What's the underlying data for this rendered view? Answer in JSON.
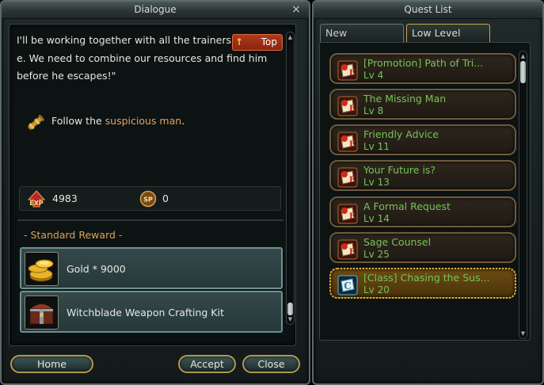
{
  "dialogue": {
    "title": "Dialogue",
    "close_symbol": "×",
    "text_line1": "I'll be working together with all the trainers, if co",
    "text_line2": "e. We need to combine our resources and find him",
    "text_line3": "before he escapes!\"",
    "top_button": "Top",
    "objective_prefix": "Follow the ",
    "objective_target": "suspicious man",
    "objective_suffix": ".",
    "exp_label": "EXP",
    "exp_value": "4983",
    "sp_label": "SP",
    "sp_value": "0",
    "standard_reward_label": "- Standard Reward -",
    "rewards": [
      {
        "name": "Gold * 9000",
        "icon": "gold-coins-icon"
      },
      {
        "name": "Witchblade Weapon Crafting Kit",
        "icon": "treasure-chest-icon"
      }
    ],
    "buttons": {
      "home": "Home",
      "accept": "Accept",
      "close": "Close"
    }
  },
  "quest_list": {
    "title": "Quest List",
    "tabs": [
      "New",
      "Low Level"
    ],
    "active_tab": "Low Level",
    "items": [
      {
        "title": "[Promotion] Path of Tri...",
        "level": "Lv 4",
        "icon": "quest-scroll-icon"
      },
      {
        "title": "The Missing Man",
        "level": "Lv 8",
        "icon": "quest-scroll-icon"
      },
      {
        "title": "Friendly Advice",
        "level": "Lv 11",
        "icon": "quest-scroll-icon"
      },
      {
        "title": "Your Future is?",
        "level": "Lv 13",
        "icon": "quest-scroll-icon"
      },
      {
        "title": "A Formal Request",
        "level": "Lv 14",
        "icon": "quest-scroll-icon"
      },
      {
        "title": "Sage Counsel",
        "level": "Lv 25",
        "icon": "quest-scroll-icon"
      },
      {
        "title": "[Class] Chasing the Sus...",
        "level": "Lv 20",
        "icon": "class-quest-icon",
        "selected": true
      }
    ]
  },
  "colors": {
    "quest_text": "#78c25a",
    "highlight_text": "#e3a45a",
    "button_border": "#b79652"
  }
}
